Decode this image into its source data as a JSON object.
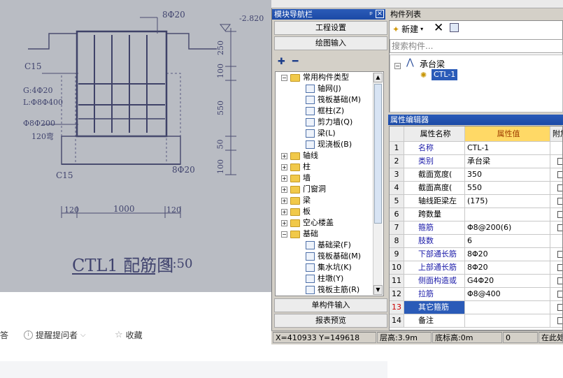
{
  "photo": {
    "title": "CTL1 配筋图",
    "scale": "1:50",
    "labels": {
      "top_rebar": "8Φ20",
      "elevation": "-2.820",
      "c15_top": "C15",
      "g_rebar": "G:4Φ20",
      "l_rebar": "L:Φ8Φ400",
      "stirrup": "Φ8Φ200",
      "hook": "120弯",
      "c15_bottom": "C15",
      "bottom_rebar": "8Φ20",
      "dim_120_left": "120",
      "dim_1000": "1000",
      "dim_120_right": "120",
      "dim_250": "250",
      "dim_100_a": "100",
      "dim_550": "550",
      "dim_50": "50",
      "dim_100_b": "100"
    }
  },
  "web": {
    "answer_fragment": "答",
    "remind_label": "提醒提问者",
    "favorite_label": "收藏"
  },
  "app": {
    "nav_panel_title": "模块导航栏",
    "nav_pin": "ᵖ ×",
    "project_settings": "工程设置",
    "drawing_input": "绘图输入",
    "single_input": "单构件输入",
    "report_preview": "报表预览",
    "tree": [
      {
        "label": "常用构件类型",
        "type": "folder",
        "expanded": true
      },
      {
        "label": "轴网(J)",
        "type": "item"
      },
      {
        "label": "筏板基础(M)",
        "type": "item"
      },
      {
        "label": "框柱(Z)",
        "type": "item"
      },
      {
        "label": "剪力墙(Q)",
        "type": "item"
      },
      {
        "label": "梁(L)",
        "type": "item"
      },
      {
        "label": "现浇板(B)",
        "type": "item"
      },
      {
        "label": "轴线",
        "type": "folder"
      },
      {
        "label": "柱",
        "type": "folder"
      },
      {
        "label": "墙",
        "type": "folder"
      },
      {
        "label": "门窗洞",
        "type": "folder"
      },
      {
        "label": "梁",
        "type": "folder"
      },
      {
        "label": "板",
        "type": "folder"
      },
      {
        "label": "空心楼盖",
        "type": "folder"
      },
      {
        "label": "基础",
        "type": "folder",
        "expanded": true
      },
      {
        "label": "基础梁(F)",
        "type": "item"
      },
      {
        "label": "筏板基础(M)",
        "type": "item"
      },
      {
        "label": "集水坑(K)",
        "type": "item"
      },
      {
        "label": "柱墩(Y)",
        "type": "item"
      },
      {
        "label": "筏板主筋(R)",
        "type": "item"
      }
    ],
    "component_list_title": "构件列表",
    "new_label": "新建",
    "search_placeholder": "搜索构件...",
    "comp_tree": {
      "root": "承台梁",
      "child": "CTL-1"
    },
    "property_editor_title": "属性编辑器",
    "grid_headers": {
      "name": "属性名称",
      "value": "属性值",
      "extra": "附加"
    },
    "properties": [
      {
        "n": "1",
        "name": "名称",
        "value": "CTL-1",
        "blue": true,
        "chk": false
      },
      {
        "n": "2",
        "name": "类别",
        "value": "承台梁",
        "blue": true,
        "chk": true
      },
      {
        "n": "3",
        "name": "截面宽度(",
        "value": "350",
        "blue": false,
        "chk": true
      },
      {
        "n": "4",
        "name": "截面高度(",
        "value": "550",
        "blue": false,
        "chk": true
      },
      {
        "n": "5",
        "name": "轴线距梁左",
        "value": "(175)",
        "blue": false,
        "chk": true
      },
      {
        "n": "6",
        "name": "跨数量",
        "value": "",
        "blue": false,
        "chk": true
      },
      {
        "n": "7",
        "name": "箍筋",
        "value": "Φ8@200(6)",
        "blue": true,
        "chk": true
      },
      {
        "n": "8",
        "name": "肢数",
        "value": "6",
        "blue": true,
        "chk": false
      },
      {
        "n": "9",
        "name": "下部通长筋",
        "value": "8Φ20",
        "blue": true,
        "chk": true
      },
      {
        "n": "10",
        "name": "上部通长筋",
        "value": "8Φ20",
        "blue": true,
        "chk": true
      },
      {
        "n": "11",
        "name": "侧面构造或",
        "value": "G4Φ20",
        "blue": true,
        "chk": true
      },
      {
        "n": "12",
        "name": "拉筋",
        "value": "Φ8@400",
        "blue": true,
        "chk": true
      },
      {
        "n": "13",
        "name": "其它箍筋",
        "value": "",
        "blue": false,
        "chk": true,
        "selected": true
      },
      {
        "n": "14",
        "name": "备注",
        "value": "",
        "blue": false,
        "chk": true
      }
    ],
    "status": {
      "coords": "X=410933 Y=149618",
      "floor_height": "层高:3.9m",
      "bottom_elev": "底标高:0m",
      "value": "0",
      "hint": "在此处"
    },
    "colors": {
      "title_bar": "#1c4aa6",
      "value_header": "#ffd966",
      "selected": "#2a5bb8"
    }
  }
}
